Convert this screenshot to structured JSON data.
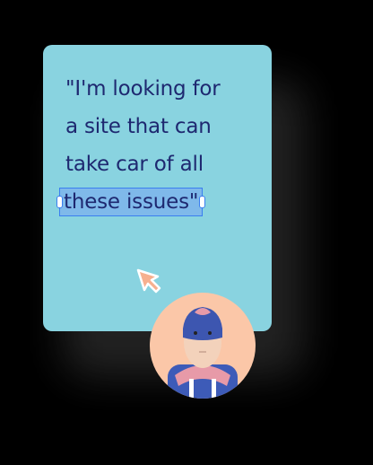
{
  "quote": {
    "lines": [
      "\"I'm looking for",
      "a site that can",
      "take car of all"
    ],
    "selected_text": "these issues\""
  },
  "colors": {
    "card": "#89d3e0",
    "text": "#1e2870",
    "selection": "#7fb9ea",
    "cursor": "#f6b08f",
    "avatar_bg": "#fbc7a8"
  },
  "icons": {
    "cursor": "pointer-arrow-icon"
  }
}
